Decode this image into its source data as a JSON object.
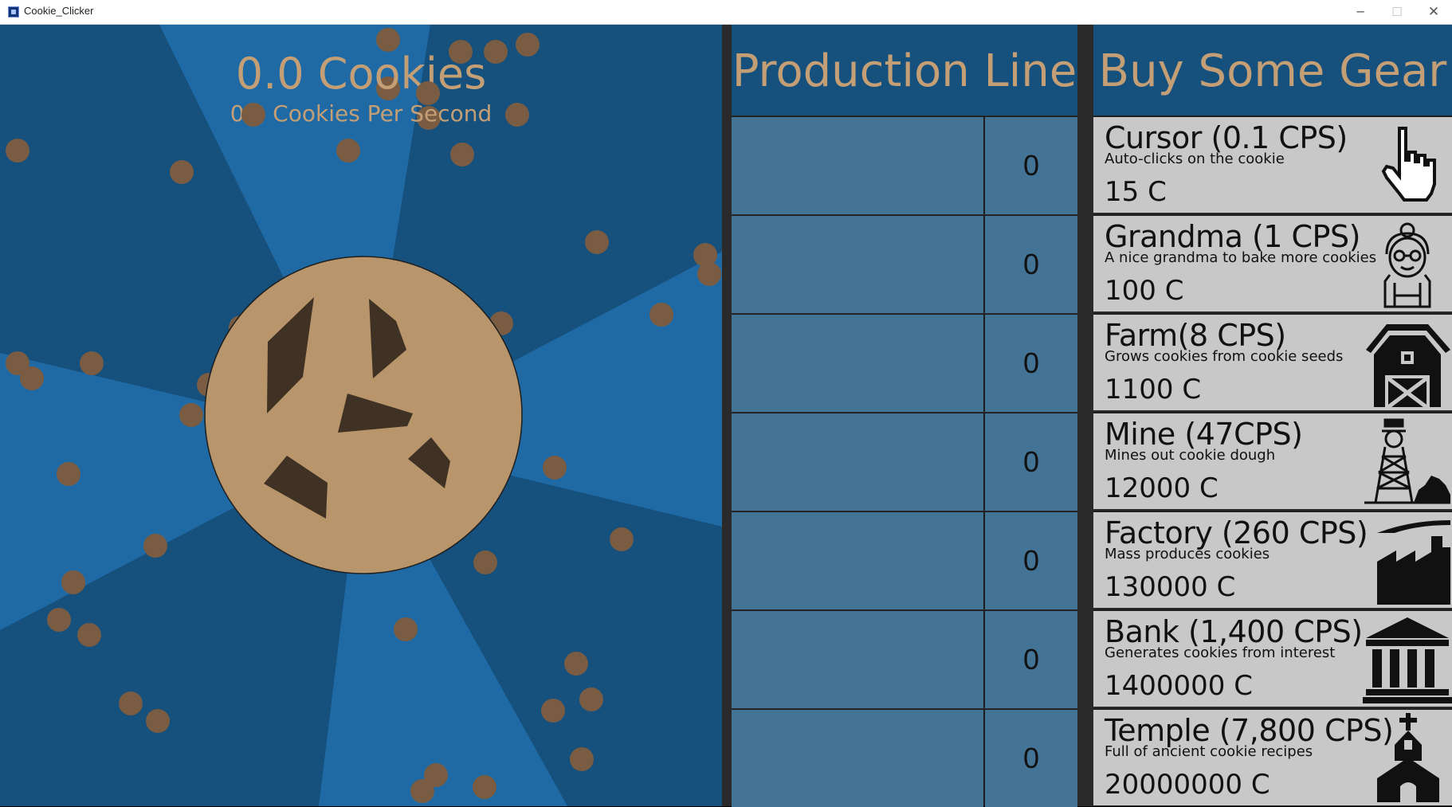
{
  "window": {
    "title": "Cookie_Clicker",
    "minimize": "─",
    "maximize": "☐",
    "close": "✕"
  },
  "cookies": {
    "count_label": "0.0 Cookies",
    "cps_label": "0.0 Cookies Per Second"
  },
  "production": {
    "header": "Production Line",
    "rows": [
      {
        "count": "0"
      },
      {
        "count": "0"
      },
      {
        "count": "0"
      },
      {
        "count": "0"
      },
      {
        "count": "0"
      },
      {
        "count": "0"
      },
      {
        "count": "0"
      }
    ]
  },
  "shop": {
    "header": "Buy Some Gear",
    "items": [
      {
        "name": "Cursor (0.1 CPS)",
        "desc": "Auto-clicks on the cookie",
        "price": "15 C",
        "icon": "hand-cursor-icon"
      },
      {
        "name": "Grandma (1 CPS)",
        "desc": "A nice grandma to bake more cookies",
        "price": "100 C",
        "icon": "grandma-icon"
      },
      {
        "name": "Farm(8 CPS)",
        "desc": "Grows cookies from cookie seeds",
        "price": "1100 C",
        "icon": "barn-icon"
      },
      {
        "name": "Mine (47CPS)",
        "desc": "Mines out cookie dough",
        "price": "12000 C",
        "icon": "mine-tower-icon"
      },
      {
        "name": "Factory (260 CPS)",
        "desc": "Mass produces cookies",
        "price": "130000 C",
        "icon": "factory-icon"
      },
      {
        "name": "Bank (1,400 CPS)",
        "desc": "Generates cookies from interest",
        "price": "1400000 C",
        "icon": "bank-icon"
      },
      {
        "name": "Temple (7,800 CPS)",
        "desc": "Full of ancient cookie recipes",
        "price": "20000000 C",
        "icon": "church-icon"
      }
    ]
  },
  "colors": {
    "background_dark": "#16507d",
    "ray_light": "#1f6aa5",
    "cookie": "#b8956b",
    "chip": "#3f3224",
    "falling_cookie": "#7a5c42",
    "title_text": "#c49f76",
    "production_cell": "#437496",
    "shop_item": "#c8c8c8"
  }
}
